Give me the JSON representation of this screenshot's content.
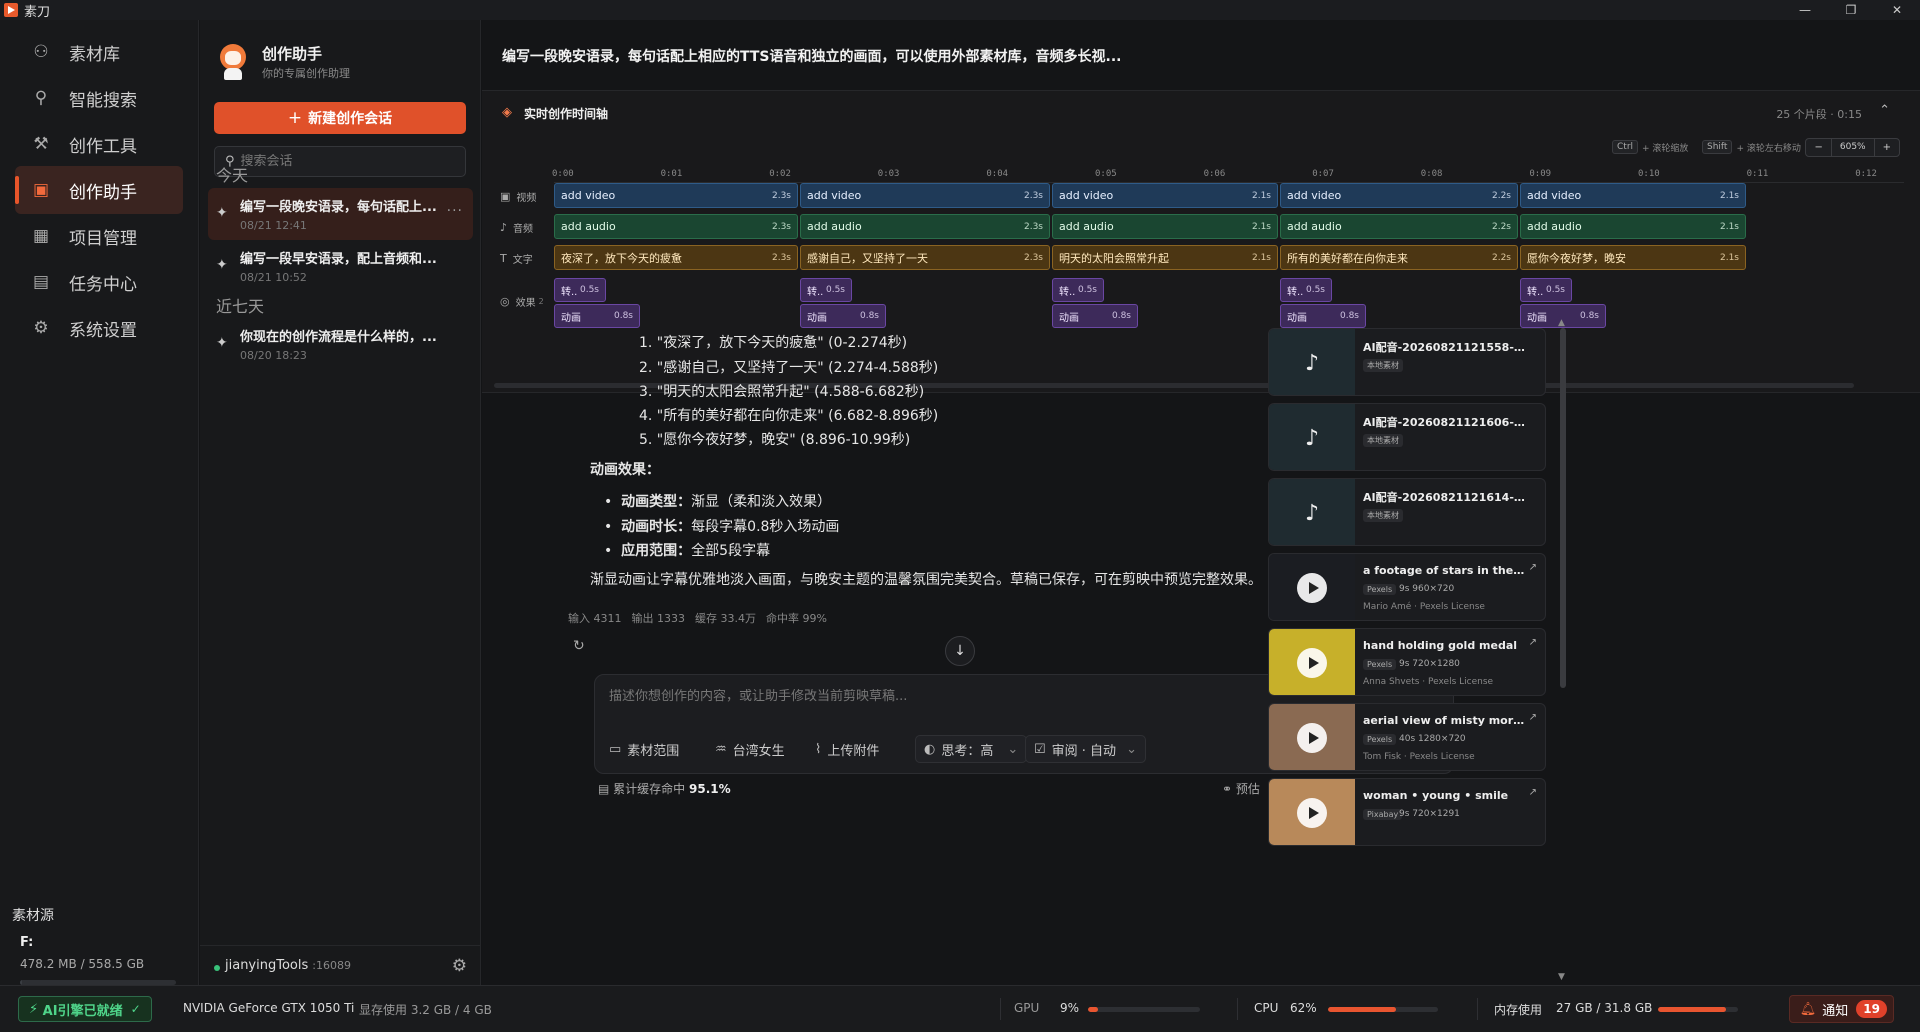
{
  "app": {
    "title": "素刀",
    "window_buttons": [
      "—",
      "❐",
      "✕"
    ]
  },
  "nav": {
    "items": [
      {
        "label": "素材库",
        "icon": "cluster-icon"
      },
      {
        "label": "智能搜索",
        "icon": "search-icon"
      },
      {
        "label": "创作工具",
        "icon": "wrench-icon"
      },
      {
        "label": "创作助手",
        "icon": "robot-icon",
        "active": true
      },
      {
        "label": "项目管理",
        "icon": "calendar-icon"
      },
      {
        "label": "任务中心",
        "icon": "clipboard-icon"
      },
      {
        "label": "系统设置",
        "icon": "gear-icon"
      }
    ],
    "source_title": "素材源",
    "source_drive": "F:",
    "source_usage": "478.2 MB / 558.5 GB",
    "source_fraction": 0.001
  },
  "sessions": {
    "title": "创作助手",
    "subtitle": "你的专属创作助理",
    "new_label": "新建创作会话",
    "search_placeholder": "搜索会话",
    "group_today": "今天",
    "group_week": "近七天",
    "items": [
      {
        "title": "编写一段晚安语录，每句话配上...",
        "date": "08/21 12:41",
        "more": "···"
      },
      {
        "title": "编写一段早安语录，配上音频和...",
        "date": "08/21 10:52"
      },
      {
        "title": "你现在的创作流程是什么样的，...",
        "date": "08/20 18:23"
      }
    ],
    "user": "jianyingTools",
    "port": ":16089"
  },
  "main": {
    "headline": "编写一段晚安语录，每句话配上相应的TTS语音和独立的画面，可以使用外部素材库，音频多长视..."
  },
  "timeline": {
    "title": "实时创作时间轴",
    "meta": "25 个片段 · 0:15",
    "hint_ctrl_key": "Ctrl",
    "hint_ctrl_text": "+ 滚轮缩放",
    "hint_shift_key": "Shift",
    "hint_shift_text": "+ 滚轮左右移动",
    "zoom_minus": "−",
    "zoom_value": "605%",
    "zoom_plus": "+",
    "ticks": [
      "0:00",
      "0:01",
      "0:02",
      "0:03",
      "0:04",
      "0:05",
      "0:06",
      "0:07",
      "0:08",
      "0:09",
      "0:10",
      "0:11",
      "0:12"
    ],
    "track_video": "视频",
    "track_audio": "音频",
    "track_text": "文字",
    "track_fx": "效果",
    "track_fx_count": "2",
    "video_clips": [
      {
        "label": "add video",
        "dur": "2.3s"
      },
      {
        "label": "add video",
        "dur": "2.3s"
      },
      {
        "label": "add video",
        "dur": "2.1s"
      },
      {
        "label": "add video",
        "dur": "2.2s"
      },
      {
        "label": "add video",
        "dur": "2.1s"
      }
    ],
    "audio_clips": [
      {
        "label": "add audio",
        "dur": "2.3s"
      },
      {
        "label": "add audio",
        "dur": "2.3s"
      },
      {
        "label": "add audio",
        "dur": "2.1s"
      },
      {
        "label": "add audio",
        "dur": "2.2s"
      },
      {
        "label": "add audio",
        "dur": "2.1s"
      }
    ],
    "text_clips": [
      {
        "label": "夜深了，放下今天的疲惫",
        "dur": "2.3s"
      },
      {
        "label": "感谢自己，又坚持了一天",
        "dur": "2.3s"
      },
      {
        "label": "明天的太阳会照常升起",
        "dur": "2.1s"
      },
      {
        "label": "所有的美好都在向你走来",
        "dur": "2.2s"
      },
      {
        "label": "愿你今夜好梦，晚安",
        "dur": "2.1s"
      }
    ],
    "fx_transition": {
      "label": "转..",
      "dur": "0.5s"
    },
    "fx_animation": {
      "label": "动画",
      "dur": "0.8s"
    }
  },
  "chat": {
    "lines": [
      "1. \"夜深了，放下今天的疲惫\" (0-2.274秒)",
      "2. \"感谢自己，又坚持了一天\" (2.274-4.588秒)",
      "3. \"明天的太阳会照常升起\" (4.588-6.682秒)",
      "4. \"所有的美好都在向你走来\" (6.682-8.896秒)",
      "5. \"愿你今夜好梦，晚安\" (8.896-10.99秒)"
    ],
    "anim_heading": "动画效果：",
    "bullets": [
      {
        "k": "动画类型：",
        "v": "渐显（柔和淡入效果）"
      },
      {
        "k": "动画时长：",
        "v": "每段字幕0.8秒入场动画"
      },
      {
        "k": "应用范围：",
        "v": "全部5段字幕"
      }
    ],
    "summary": "渐显动画让字幕优雅地淡入画面，与晚安主题的温馨氛围完美契合。草稿已保存，可在剪映中预览完整效果。",
    "tokens": [
      "输入 4311",
      "输出 1333",
      "缓存 33.4万",
      "命中率 99%"
    ],
    "composer_placeholder": "描述你想创作的内容，或让助手修改当前剪映草稿...",
    "tools": [
      "素材范围",
      "台湾女生",
      "上传附件",
      "思考：高",
      "审阅 · 自动"
    ],
    "cache_label": "累计缓存命中",
    "cache_value": "95.1%",
    "estimate": "预估"
  },
  "assets": [
    {
      "title": "AI配音-20260821121558-569f26....",
      "tag": "本地素材",
      "kind": "audio"
    },
    {
      "title": "AI配音-20260821121606-f6d301....",
      "tag": "本地素材",
      "kind": "audio"
    },
    {
      "title": "AI配音-20260821121614-7beab5....",
      "tag": "本地素材",
      "kind": "audio"
    },
    {
      "title": "a footage of stars in the sky",
      "tag": "Pexels",
      "meta": "9s  960×720",
      "credit": "Mario Amé · Pexels License",
      "kind": "video",
      "bg": "#1b1d22"
    },
    {
      "title": "hand holding gold medal",
      "tag": "Pexels",
      "meta": "9s  720×1280",
      "credit": "Anna Shvets · Pexels License",
      "kind": "video",
      "bg": "#c7b02a"
    },
    {
      "title": "aerial view of misty morning sun...",
      "tag": "Pexels",
      "meta": "40s  1280×720",
      "credit": "Tom Fisk · Pexels License",
      "kind": "video",
      "bg": "#8a6a52"
    },
    {
      "title": "woman • young • smile",
      "tag": "Pixabay",
      "meta": "9s  720×1291",
      "credit": "",
      "kind": "video",
      "bg": "#b8895a"
    }
  ],
  "status": {
    "ai_label": "AI引擎已就绪",
    "gpu_name": "NVIDIA GeForce GTX 1050 Ti",
    "vram": "显存使用 3.2 GB / 4 GB",
    "gpu_label": "GPU",
    "gpu_value": "9%",
    "gpu_fraction": 0.09,
    "cpu_label": "CPU",
    "cpu_value": "62%",
    "cpu_fraction": 0.62,
    "mem_label": "内存使用",
    "mem_value": "27 GB / 31.8 GB",
    "mem_fraction": 0.85,
    "notify_label": "通知",
    "notify_count": "19"
  }
}
